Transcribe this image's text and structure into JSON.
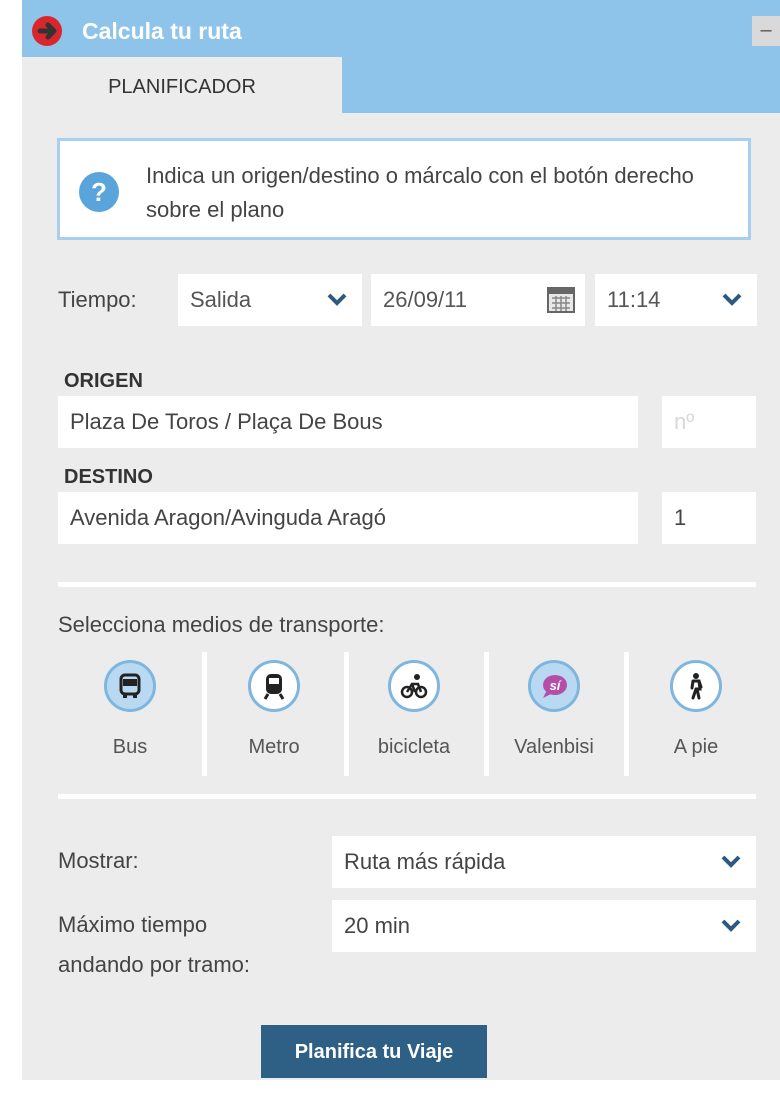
{
  "window": {
    "title": "Calcula tu ruta",
    "minimize": "–"
  },
  "tabs": [
    {
      "label": "PLANIFICADOR"
    }
  ],
  "info": {
    "text": "Indica un origen/destino o márcalo con el botón derecho sobre el plano"
  },
  "tiempo": {
    "label": "Tiempo:",
    "mode": "Salida",
    "date": "26/09/11",
    "time": "11:14"
  },
  "origen": {
    "title": "ORIGEN",
    "value": "Plaza De Toros / Plaça De Bous",
    "number_placeholder": "nº",
    "number": ""
  },
  "destino": {
    "title": "DESTINO",
    "value": "Avenida Aragon/Avinguda Aragó",
    "number": "1"
  },
  "transport": {
    "title": "Selecciona medios de transporte:",
    "modes": [
      {
        "label": "Bus",
        "icon": "bus-icon",
        "selected": true
      },
      {
        "label": "Metro",
        "icon": "metro-icon",
        "selected": false
      },
      {
        "label": "bicicleta",
        "icon": "bicycle-icon",
        "selected": false
      },
      {
        "label": "Valenbisi",
        "icon": "valenbisi-icon",
        "selected": true
      },
      {
        "label": "A pie",
        "icon": "walk-icon",
        "selected": false
      }
    ]
  },
  "mostrar": {
    "label": "Mostrar:",
    "value": "Ruta más rápida"
  },
  "walking": {
    "label_line1": "Máximo tiempo",
    "label_line2": "andando por tramo:",
    "value": "20 min"
  },
  "submit": {
    "label": "Planifica tu Viaje"
  },
  "colors": {
    "header": "#8fc4ea",
    "panel": "#ececec",
    "button": "#2e5f85",
    "accent_border": "#a8d0ee",
    "icon_purple": "#b44fa8"
  }
}
